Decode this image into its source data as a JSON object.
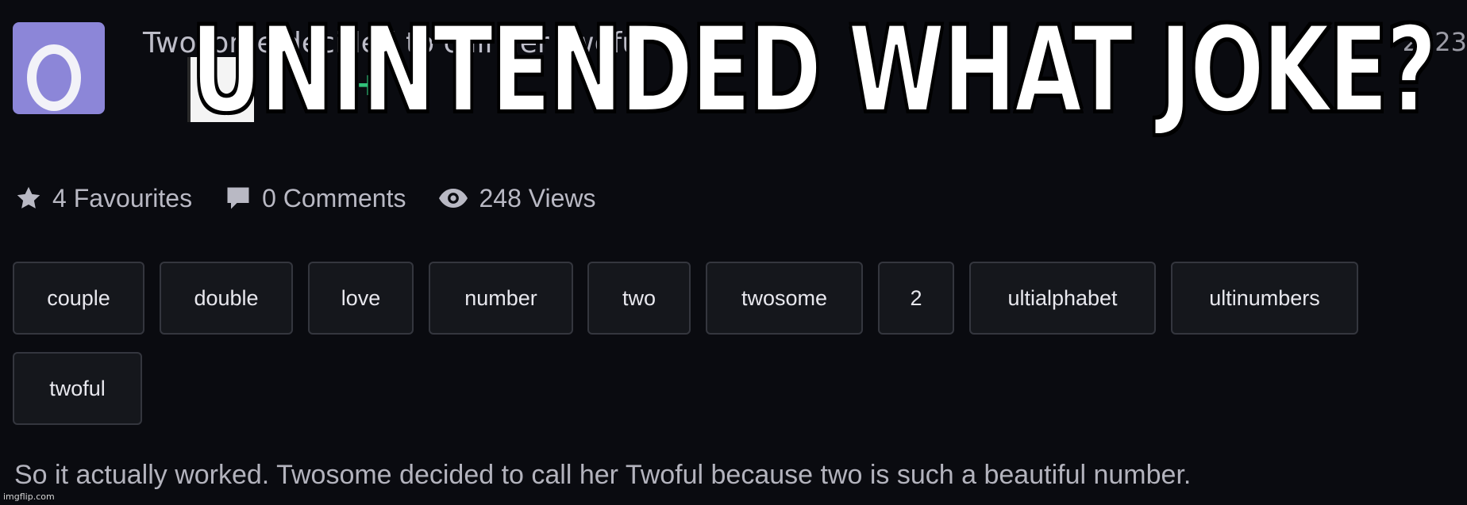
{
  "header": {
    "title_fragment": "Twosome decided to call her Twoful",
    "date_fragment": "2023",
    "caption": "UNINTENDED WHAT JOKE?"
  },
  "stats": {
    "favourites": "4 Favourites",
    "comments": "0 Comments",
    "views": "248 Views"
  },
  "icons": {
    "favourites": "star-icon",
    "comments": "comment-icon",
    "views": "eye-icon"
  },
  "tags": [
    "couple",
    "double",
    "love",
    "number",
    "two",
    "twosome",
    "2",
    "ultialphabet",
    "ultinumbers",
    "twoful"
  ],
  "description": "So it actually worked. Twosome decided to call her Twoful because two is such a beautiful number.",
  "watermark": "imgflip.com",
  "colors": {
    "background": "#0a0b10",
    "tag_background": "#15171c",
    "tag_border": "#34363e",
    "muted_text": "#b9b9c4",
    "avatar": "#8c86d8",
    "accent_green": "#31c27a"
  }
}
